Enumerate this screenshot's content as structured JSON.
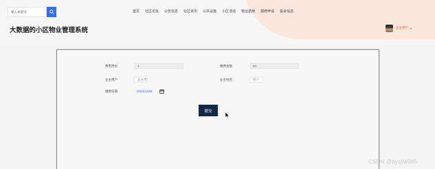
{
  "search": {
    "placeholder": "输入关键词"
  },
  "nav": {
    "items": [
      "首页",
      "社区论坛",
      "公告信息",
      "社区资讯",
      "公共设施",
      "小区活动",
      "物业费用",
      "报修申请",
      "投诉信息"
    ]
  },
  "header": {
    "title": "大数据的小区物业管理系统"
  },
  "user": {
    "name": "业主用户"
  },
  "form": {
    "fee_month": {
      "label": "费用月份",
      "value": "1"
    },
    "repair_amount": {
      "label": "缴费金额",
      "value": "50"
    },
    "owner_account": {
      "label": "业主用户",
      "value": "业主用"
    },
    "owner_name": {
      "label": "业主姓名",
      "value": "用户"
    },
    "pay_date": {
      "label": "缴费日期",
      "value": "2023/12/08"
    },
    "submit_label": "提交"
  },
  "watermark": "CSDN @bysjlw985",
  "colors": {
    "accent": "#2f6ff0",
    "user": "#e8642c",
    "submit_bg": "#13294b"
  }
}
